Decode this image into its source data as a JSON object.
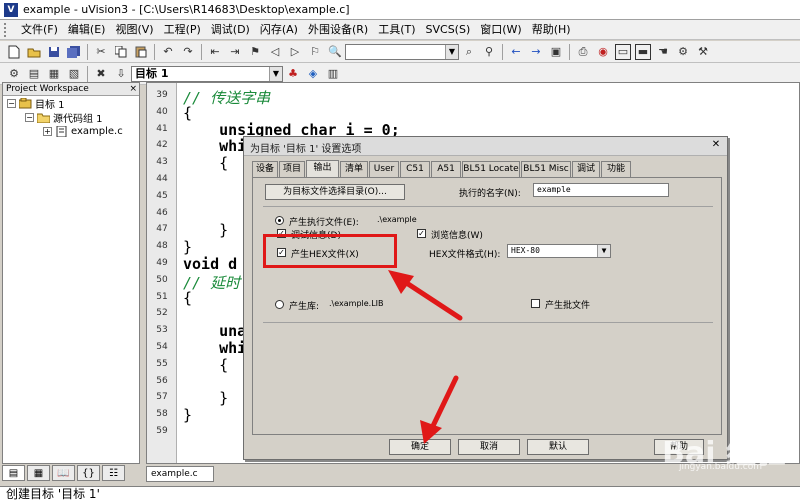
{
  "window": {
    "title": "example - uVision3 - [C:\\Users\\R14683\\Desktop\\example.c]",
    "app_icon_glyph": "V"
  },
  "menu": [
    "文件(F)",
    "编辑(E)",
    "视图(V)",
    "工程(P)",
    "调试(D)",
    "闪存(A)",
    "外围设备(R)",
    "工具(T)",
    "SVCS(S)",
    "窗口(W)",
    "帮助(H)"
  ],
  "toolbar2": {
    "target_select": "目标 1"
  },
  "project": {
    "header": "Project Workspace",
    "close_glyph": "×",
    "tree": {
      "target": "目标 1",
      "group": "源代码组 1",
      "file": "example.c"
    }
  },
  "editor": {
    "lines": [
      {
        "n": "39",
        "text": "// 传送字串",
        "kind": "comment"
      },
      {
        "n": "40",
        "text": "{",
        "kind": "brace"
      },
      {
        "n": "41",
        "text": "    unsigned char i = 0;",
        "kind": "code"
      },
      {
        "n": "42",
        "text": "    whi",
        "kind": "code"
      },
      {
        "n": "43",
        "text": "    {",
        "kind": "brace"
      },
      {
        "n": "44",
        "text": "",
        "kind": "code"
      },
      {
        "n": "45",
        "text": "",
        "kind": "code"
      },
      {
        "n": "46",
        "text": "",
        "kind": "code"
      },
      {
        "n": "47",
        "text": "    }",
        "kind": "brace"
      },
      {
        "n": "48",
        "text": "}",
        "kind": "brace"
      },
      {
        "n": "49",
        "text": "void d",
        "kind": "code"
      },
      {
        "n": "50",
        "text": "// 延时",
        "kind": "comment"
      },
      {
        "n": "51",
        "text": "{",
        "kind": "brace"
      },
      {
        "n": "52",
        "text": "",
        "kind": "code"
      },
      {
        "n": "53",
        "text": "    una",
        "kind": "code"
      },
      {
        "n": "54",
        "text": "    whi",
        "kind": "code"
      },
      {
        "n": "55",
        "text": "    {",
        "kind": "brace"
      },
      {
        "n": "56",
        "text": "",
        "kind": "code"
      },
      {
        "n": "57",
        "text": "    }",
        "kind": "brace"
      },
      {
        "n": "58",
        "text": "}",
        "kind": "brace"
      },
      {
        "n": "59",
        "text": "",
        "kind": "code"
      }
    ],
    "file_tab": "example.c"
  },
  "output": {
    "text": "创建目标 '目标 1'"
  },
  "dialog": {
    "title": "为目标 '目标 1' 设置选项",
    "close_glyph": "✕",
    "tabs": [
      "设备",
      "项目",
      "输出",
      "清单",
      "User",
      "C51",
      "A51",
      "BL51 Locate",
      "BL51 Misc",
      "调试",
      "功能"
    ],
    "active_tab": "输出",
    "select_dir_button": "为目标文件选择目录(O)...",
    "exe_name_label": "执行的名字(N):",
    "exe_name_value": "example",
    "create_exe_label": "产生执行文件(E):",
    "create_exe_path": ".\\example",
    "debug_info_label": "调试信息(D)",
    "browse_info_label": "浏览信息(W)",
    "create_hex_label": "产生HEX文件(X)",
    "hex_format_label": "HEX文件格式(H):",
    "hex_format_value": "HEX-80",
    "create_lib_label": "产生库:",
    "create_lib_path": ".\\example.LIB",
    "batch_label": "产生批文件",
    "check_glyph": "✓",
    "ok_button": "确定",
    "cancel_button": "取消",
    "defaults_button": "默认",
    "help_button": "帮助"
  },
  "watermark": {
    "text": "Bai 经验",
    "sub": "jingyan.baidu.com"
  },
  "annotation_color": "#e01818"
}
